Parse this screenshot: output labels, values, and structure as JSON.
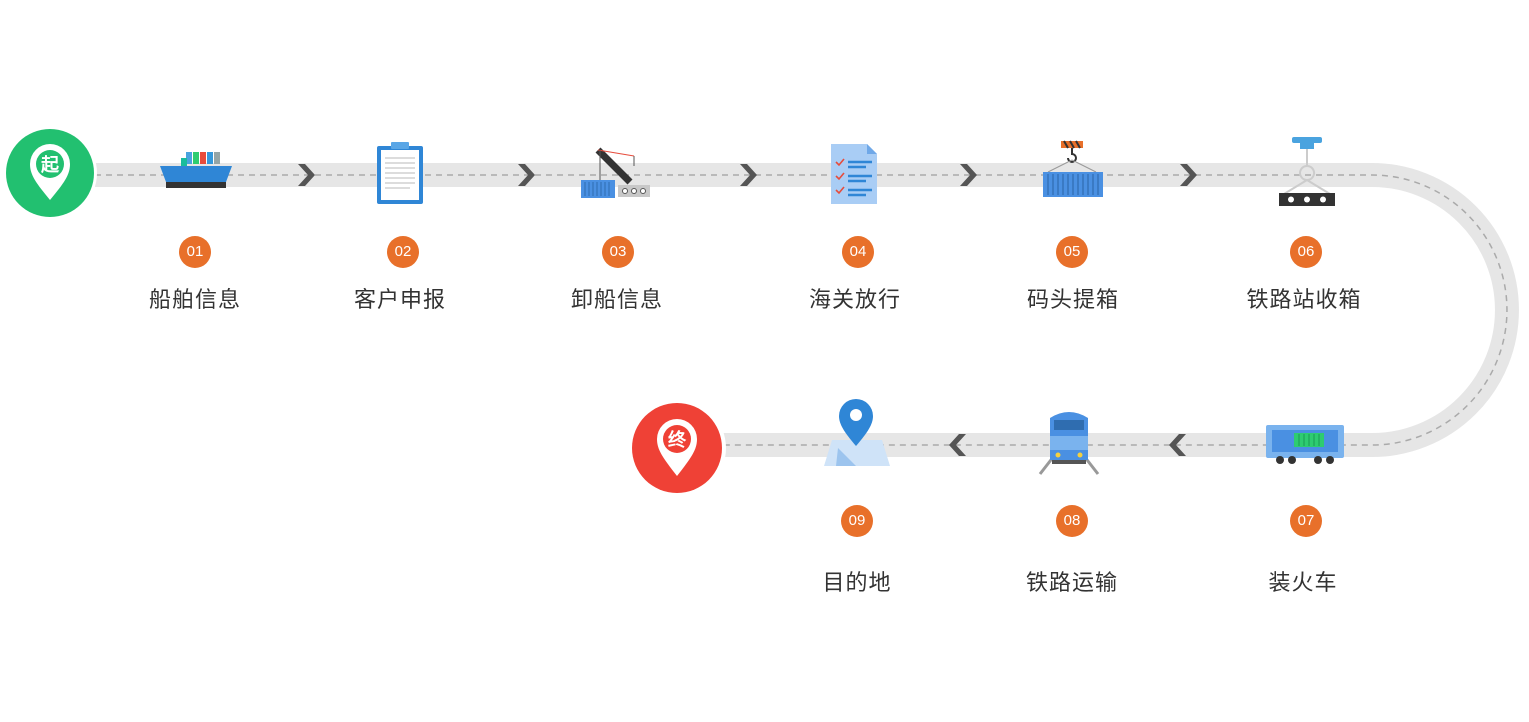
{
  "start_marker": {
    "text": "起",
    "color": "#22c070"
  },
  "end_marker": {
    "text": "终",
    "color": "#ef4136"
  },
  "steps": [
    {
      "num": "01",
      "label": "船舶信息",
      "icon": "ship-icon"
    },
    {
      "num": "02",
      "label": "客户申报",
      "icon": "clipboard-icon"
    },
    {
      "num": "03",
      "label": "卸船信息",
      "icon": "crane-unload-icon"
    },
    {
      "num": "04",
      "label": "海关放行",
      "icon": "checklist-icon"
    },
    {
      "num": "05",
      "label": "码头提箱",
      "icon": "container-hook-icon"
    },
    {
      "num": "06",
      "label": "铁路站收箱",
      "icon": "gantry-icon"
    },
    {
      "num": "07",
      "label": "装火车",
      "icon": "freight-car-icon"
    },
    {
      "num": "08",
      "label": "铁路运输",
      "icon": "train-icon"
    },
    {
      "num": "09",
      "label": "目的地",
      "icon": "map-pin-icon"
    }
  ],
  "colors": {
    "track": "#e6e6e6",
    "dash": "#aaaaaa",
    "chevron": "#555555",
    "badge": "#e8702a"
  }
}
